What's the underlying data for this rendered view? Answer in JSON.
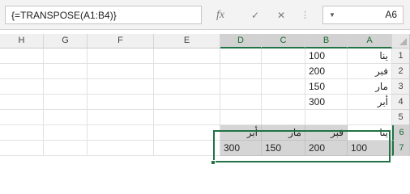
{
  "formula_bar": {
    "formula": "{=TRANSPOSE(A1:B4)}",
    "name_box": "A6",
    "fx_label": "fx",
    "enter_glyph": "✓",
    "cancel_glyph": "✕",
    "grip_glyph": "⋮"
  },
  "grid": {
    "corner_glyph": "◢",
    "columns": [
      "A",
      "B",
      "C",
      "D",
      "E",
      "F",
      "G",
      "H"
    ],
    "rows": [
      "1",
      "2",
      "3",
      "4",
      "5",
      "6",
      "7"
    ],
    "cells": {
      "A1": "ينا",
      "B1": "100",
      "A2": "فبر",
      "B2": "200",
      "A3": "مار",
      "B3": "150",
      "A4": "أبر",
      "B4": "300",
      "A6": "ينا",
      "B6": "فبر",
      "C6": "مار",
      "D6": "أبر",
      "A7": "100",
      "B7": "200",
      "C7": "150",
      "D7": "300"
    }
  },
  "colors": {
    "selection_border": "#217346",
    "header_bg": "#f0f0f0",
    "selected_header_bg": "#d2d2d2",
    "result_fill": "#d5d5d5"
  },
  "icons": {
    "name_box_dropdown": "chevron-down-icon",
    "grip": "grip-icon",
    "cancel": "close-icon",
    "enter": "check-icon",
    "function": "fx-icon",
    "select_all": "select-all-triangle-icon"
  }
}
